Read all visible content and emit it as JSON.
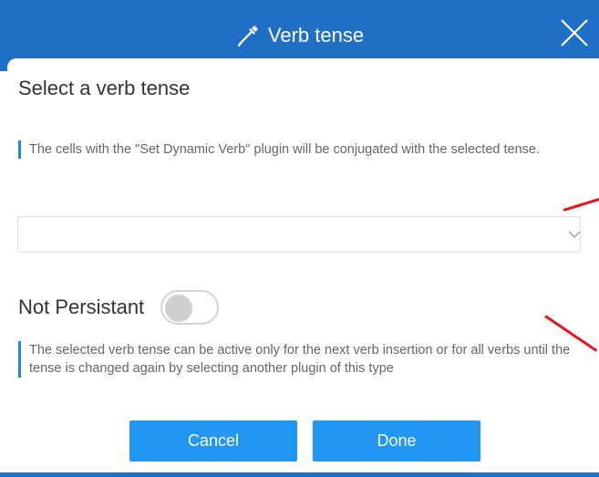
{
  "dialog": {
    "title": "Verb tense",
    "title_icon": "eyedropper-icon",
    "close_icon": "close-icon"
  },
  "content": {
    "heading": "Select a verb tense",
    "info_text": "The cells with the \"Set Dynamic Verb\" plugin will be conjugated with the selected tense.",
    "tense_select": {
      "value": "",
      "icon": "chevron-down-icon"
    },
    "toggle": {
      "label": "Not Persistant",
      "checked": false
    },
    "toggle_info": "The selected verb tense can be active only for the next verb insertion or for all verbs until the tense is changed again by selecting another plugin of this type"
  },
  "buttons": {
    "cancel": "Cancel",
    "done": "Done"
  },
  "colors": {
    "header": "#1e6fc5",
    "button": "#2196f3",
    "info_bar": "#1e88e5",
    "annotation": "#e8141e"
  }
}
